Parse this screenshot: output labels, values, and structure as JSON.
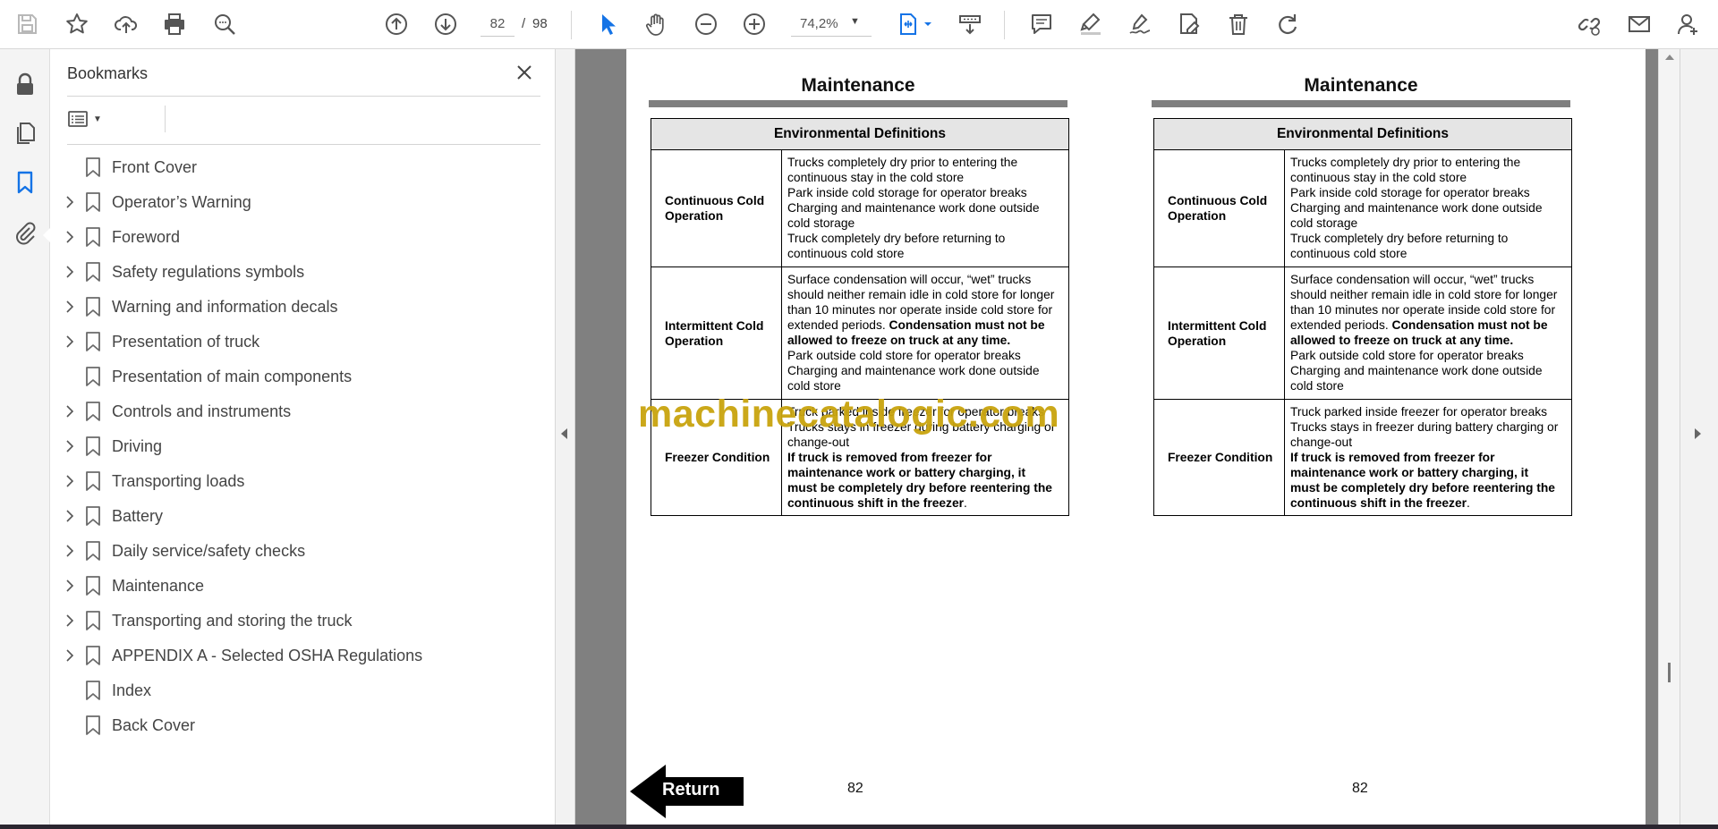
{
  "toolbar": {
    "icons": [
      "save-icon",
      "star-icon",
      "cloud-upload-icon",
      "print-icon",
      "find-icon",
      "page-up-icon",
      "page-down-icon",
      "select-arrow-icon",
      "hand-icon",
      "zoom-out-icon",
      "zoom-in-icon",
      "fit-page-icon",
      "scroll-mode-icon",
      "comment-icon",
      "highlight-icon",
      "sign-icon",
      "edit-pdf-icon",
      "delete-icon",
      "redo-icon",
      "share-link-icon",
      "email-icon",
      "account-icon"
    ],
    "page_current": "82",
    "page_separator": "/",
    "page_total": "98",
    "zoom_value": "74,2%",
    "accent_color": "#1473e6"
  },
  "bookmarks": {
    "title": "Bookmarks",
    "items": [
      {
        "label": "Front Cover",
        "expandable": false
      },
      {
        "label": "Operator’s Warning",
        "expandable": true
      },
      {
        "label": "Foreword",
        "expandable": true
      },
      {
        "label": "Safety regulations symbols",
        "expandable": true
      },
      {
        "label": "Warning and information decals",
        "expandable": true
      },
      {
        "label": "Presentation of truck",
        "expandable": true
      },
      {
        "label": "Presentation of main components",
        "expandable": false
      },
      {
        "label": "Controls and instruments",
        "expandable": true
      },
      {
        "label": "Driving",
        "expandable": true
      },
      {
        "label": "Transporting loads",
        "expandable": true
      },
      {
        "label": "Battery",
        "expandable": true
      },
      {
        "label": "Daily service/safety checks",
        "expandable": true
      },
      {
        "label": "Maintenance",
        "expandable": true
      },
      {
        "label": "Transporting and storing the truck",
        "expandable": true
      },
      {
        "label": "APPENDIX A - Selected OSHA Regulations",
        "expandable": true
      },
      {
        "label": "Index",
        "expandable": false
      },
      {
        "label": "Back Cover",
        "expandable": false
      }
    ]
  },
  "document": {
    "columns": [
      {
        "heading": "Maintenance",
        "table_header": "Environmental Definitions",
        "rows": {
          "continuous": {
            "label_line1": "Continuous Cold",
            "label_line2": "Operation",
            "lines": [
              "Trucks completely dry prior to entering the",
              "continuous stay in the cold store",
              "Park inside cold storage for operator breaks",
              "Charging and maintenance work done outside",
              "cold storage",
              "Truck completely dry before returning to",
              "continuous cold store"
            ]
          },
          "intermittent": {
            "label_line1": "Intermittent Cold",
            "label_line2": "Operation",
            "lines": [
              "Surface condensation will occur, “wet” trucks",
              "should neither remain idle in cold store for longer",
              "than 10 minutes nor operate inside cold store for"
            ],
            "line4_plain": "extended periods. ",
            "line4_bold": "Condensation must not be",
            "line5_bold": "allowed to freeze on truck at any time.",
            "tail_lines": [
              "Park outside cold store for operator breaks",
              "Charging and maintenance work done outside",
              "cold store"
            ]
          },
          "freezer": {
            "label": "Freezer Condition",
            "lines": [
              "Truck parked inside freezer for operator breaks",
              "Trucks stays in freezer during battery charging or",
              "change-out"
            ],
            "bold_lines": [
              "If truck is removed from freezer for",
              "maintenance work or battery charging, it",
              "must be completely dry before reentering the"
            ],
            "last_bold": "continuous shift in the freezer",
            "last_plain": "."
          }
        },
        "page_number": "82"
      },
      {
        "heading": "Maintenance",
        "table_header": "Environmental Definitions",
        "rows": {
          "continuous": {
            "label_line1": "Continuous Cold",
            "label_line2": "Operation",
            "lines": [
              "Trucks completely dry prior to entering the",
              "continuous stay in the cold store",
              "Park inside cold storage for operator breaks",
              "Charging and maintenance work done outside",
              "cold storage",
              "Truck completely dry before returning to",
              "continuous cold store"
            ]
          },
          "intermittent": {
            "label_line1": "Intermittent Cold",
            "label_line2": "Operation",
            "lines": [
              "Surface condensation will occur, “wet” trucks",
              "should neither remain idle in cold store for longer",
              "than 10 minutes nor operate inside cold store for"
            ],
            "line4_plain": "extended periods. ",
            "line4_bold": "Condensation must not be",
            "line5_bold": "allowed to freeze on truck at any time.",
            "tail_lines": [
              "Park outside cold store for operator breaks",
              "Charging and maintenance work done outside",
              "cold store"
            ]
          },
          "freezer": {
            "label": "Freezer Condition",
            "lines": [
              "Truck parked inside freezer for operator breaks",
              "Trucks stays in freezer during battery charging or",
              "change-out"
            ],
            "bold_lines": [
              "If truck is removed from freezer for",
              "maintenance work or battery charging, it",
              "must be completely dry before reentering the"
            ],
            "last_bold": "continuous shift in the freezer",
            "last_plain": "."
          }
        },
        "page_number": "82"
      }
    ],
    "watermark": "machinecatalogic.com",
    "watermark_color": "#c9a40e",
    "return_label": "Return"
  }
}
